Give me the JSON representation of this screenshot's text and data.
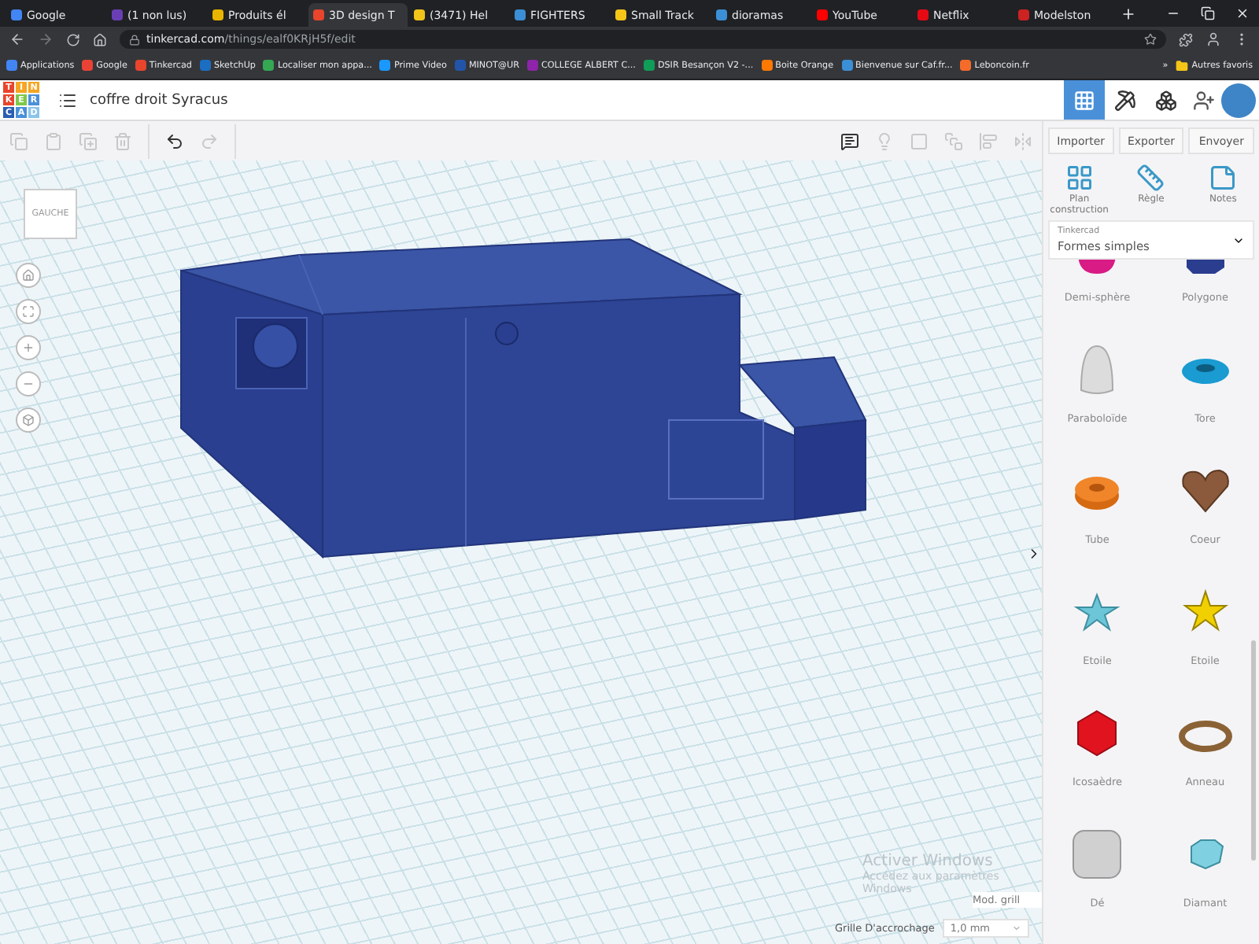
{
  "browser": {
    "tabs": [
      {
        "label": "Google",
        "selected": false,
        "color": "#4285f4"
      },
      {
        "label": "(1 non lus)",
        "selected": false,
        "color": "#6a3fb5"
      },
      {
        "label": "Produits él",
        "selected": false,
        "color": "#e8b400"
      },
      {
        "label": "3D design T",
        "selected": true,
        "color": "#e8452c"
      },
      {
        "label": "(3471) Hel",
        "selected": false,
        "color": "#f0c419"
      },
      {
        "label": "FIGHTERS",
        "selected": false,
        "color": "#3b8fd6"
      },
      {
        "label": "Small Track",
        "selected": false,
        "color": "#f5c518"
      },
      {
        "label": "dioramas",
        "selected": false,
        "color": "#3b8fd6"
      },
      {
        "label": "YouTube",
        "selected": false,
        "color": "#ff0000"
      },
      {
        "label": "Netflix",
        "selected": false,
        "color": "#e50914"
      },
      {
        "label": "Modelston",
        "selected": false,
        "color": "#cc2222"
      }
    ],
    "url_host": "tinkercad.com",
    "url_path": "/things/ealf0KRjH5f/edit",
    "bookmarks": [
      {
        "label": "Applications",
        "color": "#4285f4"
      },
      {
        "label": "Google",
        "color": "#ea4335"
      },
      {
        "label": "Tinkercad",
        "color": "#e8452c"
      },
      {
        "label": "SketchUp",
        "color": "#1b6ec2"
      },
      {
        "label": "Localiser mon appa...",
        "color": "#34a853"
      },
      {
        "label": "Prime Video",
        "color": "#1a98ff"
      },
      {
        "label": "MINOT@UR",
        "color": "#2255aa"
      },
      {
        "label": "COLLEGE ALBERT C...",
        "color": "#8e24aa"
      },
      {
        "label": "DSIR Besançon V2 -...",
        "color": "#0f9d58"
      },
      {
        "label": "Boite Orange",
        "color": "#ff7900"
      },
      {
        "label": "Bienvenue sur Caf.fr...",
        "color": "#3b8fd6"
      },
      {
        "label": "Leboncoin.fr",
        "color": "#f56b2a"
      }
    ],
    "more": "»",
    "other_bookmarks": "Autres favoris"
  },
  "app": {
    "logo": [
      "T",
      "I",
      "N",
      "K",
      "E",
      "R",
      "C",
      "A",
      "D"
    ],
    "design_title": "coffre droit Syracus",
    "modes": [
      {
        "kind": "grid",
        "selected": true
      },
      {
        "kind": "pickaxe",
        "selected": false
      },
      {
        "kind": "bricks",
        "selected": false
      }
    ]
  },
  "toolbar": {
    "edit_tools": [
      {
        "kind": "copy",
        "disabled": true
      },
      {
        "kind": "paste",
        "disabled": true
      },
      {
        "kind": "duplicate",
        "disabled": true
      },
      {
        "kind": "delete",
        "disabled": true
      },
      {
        "kind": "undo",
        "disabled": false
      },
      {
        "kind": "redo",
        "disabled": true
      }
    ],
    "view_tools": [
      {
        "kind": "notes",
        "disabled": false
      },
      {
        "kind": "light",
        "disabled": true
      },
      {
        "kind": "shape",
        "disabled": true
      },
      {
        "kind": "group",
        "disabled": true
      },
      {
        "kind": "align",
        "disabled": true
      },
      {
        "kind": "mirror",
        "disabled": true
      }
    ]
  },
  "canvas": {
    "view_cube": "GAUCHE",
    "watermark": [
      "Activer Windows",
      "Accédez aux paramètres",
      "Windows"
    ],
    "edit_grid": "Mod. grill",
    "snap_label": "Grille D'accrochage",
    "snap_value": "1,0 mm"
  },
  "panel": {
    "actions": [
      "Importer",
      "Exporter",
      "Envoyer"
    ],
    "tools": [
      {
        "kind": "workplane",
        "label": "Plan construction"
      },
      {
        "kind": "ruler",
        "label": "Règle"
      },
      {
        "kind": "notes",
        "label": "Notes"
      }
    ],
    "library": {
      "source": "Tinkercad",
      "value": "Formes simples"
    },
    "shapes": [
      {
        "kind": "hemisphere",
        "label": "Demi-sphère"
      },
      {
        "kind": "polygon",
        "label": "Polygone"
      },
      {
        "kind": "paraboloid",
        "label": "Paraboloïde"
      },
      {
        "kind": "torus",
        "label": "Tore"
      },
      {
        "kind": "tube",
        "label": "Tube"
      },
      {
        "kind": "heart",
        "label": "Coeur"
      },
      {
        "kind": "star",
        "label": "Etoile"
      },
      {
        "kind": "star_gold",
        "label": "Etoile"
      },
      {
        "kind": "icosahedron",
        "label": "Icosaèdre"
      },
      {
        "kind": "ring",
        "label": "Anneau"
      },
      {
        "kind": "die",
        "label": "Dé"
      },
      {
        "kind": "diamond",
        "label": "Diamant"
      }
    ]
  }
}
